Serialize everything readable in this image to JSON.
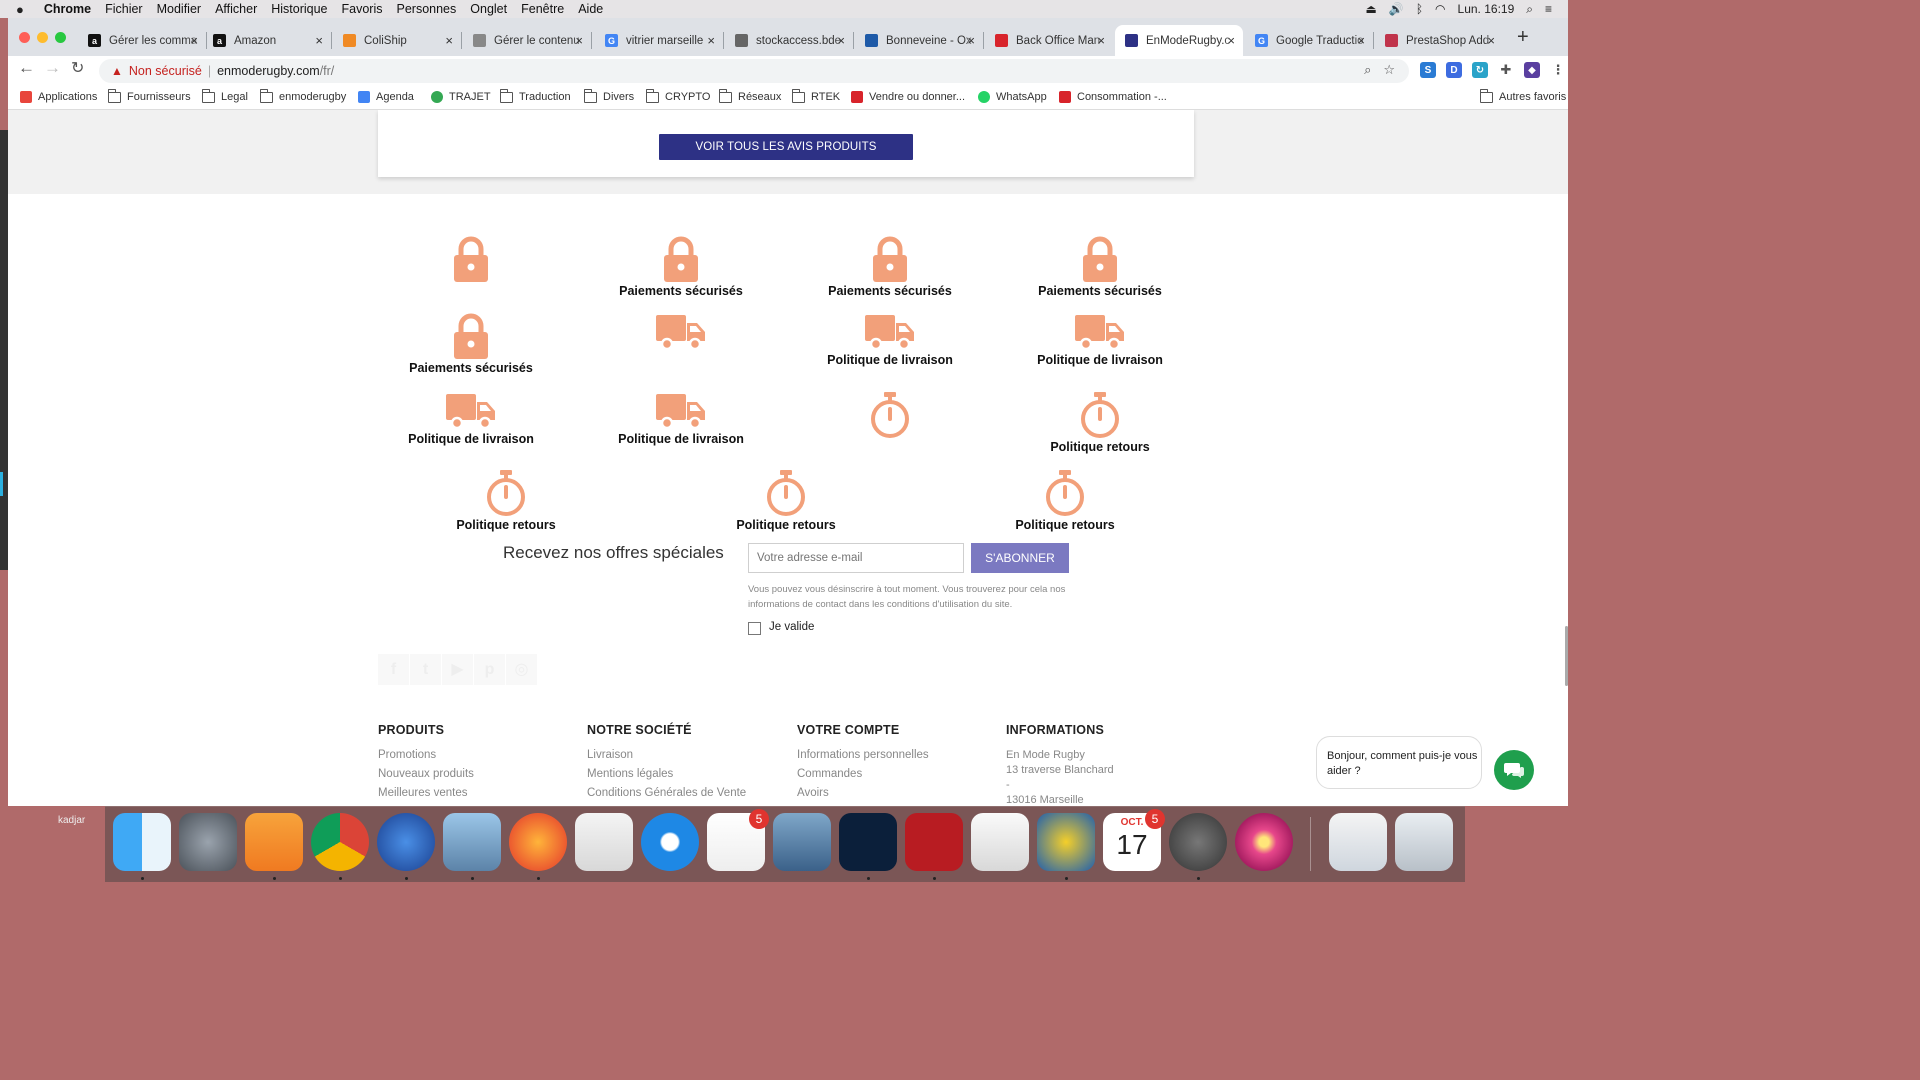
{
  "menubar": {
    "app": "Chrome",
    "items": [
      "Fichier",
      "Modifier",
      "Afficher",
      "Historique",
      "Favoris",
      "Personnes",
      "Onglet",
      "Fenêtre",
      "Aide"
    ],
    "clock": "Lun. 16:19"
  },
  "tabs": [
    {
      "title": "Gérer les comma",
      "fav": "a",
      "color": "#111"
    },
    {
      "title": "Amazon",
      "fav": "a",
      "color": "#111"
    },
    {
      "title": "ColiShip",
      "fav": "",
      "color": "#f08a24"
    },
    {
      "title": "Gérer le contenu",
      "fav": "",
      "color": "#888"
    },
    {
      "title": "vitrier marseille",
      "fav": "G",
      "color": "#4285f4"
    },
    {
      "title": "stockaccess.bde",
      "fav": "",
      "color": "#666"
    },
    {
      "title": "Bonneveine - Ox",
      "fav": "",
      "color": "#1e5aa8"
    },
    {
      "title": "Back Office Man",
      "fav": "",
      "color": "#d8242b"
    },
    {
      "title": "EnModeRugby.c",
      "fav": "",
      "color": "#2d3185"
    },
    {
      "title": "Google Traductio",
      "fav": "G",
      "color": "#4285f4"
    },
    {
      "title": "PrestaShop Add",
      "fav": "",
      "color": "#c0334b"
    }
  ],
  "omnibox": {
    "security": "Non sécurisé",
    "domain": "enmoderugby.com",
    "path": "/fr/"
  },
  "bookmarks": [
    {
      "label": "Applications",
      "type": "apps"
    },
    {
      "label": "Fournisseurs",
      "type": "folder"
    },
    {
      "label": "Legal",
      "type": "folder"
    },
    {
      "label": "enmoderugby",
      "type": "folder"
    },
    {
      "label": "Agenda",
      "type": "cal"
    },
    {
      "label": "TRAJET",
      "type": "map"
    },
    {
      "label": "Traduction",
      "type": "folder"
    },
    {
      "label": "Divers",
      "type": "folder"
    },
    {
      "label": "CRYPTO",
      "type": "folder"
    },
    {
      "label": "Réseaux",
      "type": "folder"
    },
    {
      "label": "RTEK",
      "type": "folder"
    },
    {
      "label": "Vendre ou donner...",
      "type": "fr"
    },
    {
      "label": "WhatsApp",
      "type": "wa"
    },
    {
      "label": "Consommation -...",
      "type": "fr"
    }
  ],
  "bookmarks_other": "Autres favoris",
  "reviews": {
    "button": "VOIR TOUS LES AVIS PRODUITS"
  },
  "features": {
    "accent": "#f2a07a",
    "labels": {
      "payment": "Paiements sécurisés",
      "delivery": "Politique de livraison",
      "returns": "Politique retours"
    },
    "items": [
      {
        "icon": "lock-icon",
        "label": ""
      },
      {
        "icon": "lock-icon",
        "label": "Paiements sécurisés"
      },
      {
        "icon": "lock-icon",
        "label": "Paiements sécurisés"
      },
      {
        "icon": "lock-icon",
        "label": "Paiements sécurisés"
      },
      {
        "icon": "lock-icon",
        "label": "Paiements sécurisés"
      },
      {
        "icon": "truck-icon",
        "label": ""
      },
      {
        "icon": "truck-icon",
        "label": "Politique de livraison"
      },
      {
        "icon": "truck-icon",
        "label": "Politique de livraison"
      },
      {
        "icon": "truck-icon",
        "label": "Politique de livraison"
      },
      {
        "icon": "truck-icon",
        "label": "Politique de livraison"
      },
      {
        "icon": "stopwatch-icon",
        "label": ""
      },
      {
        "icon": "stopwatch-icon",
        "label": "Politique retours"
      },
      {
        "icon": "stopwatch-icon",
        "label": "Politique retours"
      },
      {
        "icon": "stopwatch-icon",
        "label": "Politique retours"
      },
      {
        "icon": "stopwatch-icon",
        "label": "Politique retours"
      }
    ]
  },
  "newsletter": {
    "title": "Recevez nos offres spéciales",
    "placeholder": "Votre adresse e-mail",
    "button": "S'ABONNER",
    "note": "Vous pouvez vous désinscrire à tout moment. Vous trouverez pour cela nos informations de contact dans les conditions d'utilisation du site.",
    "checkbox_label": "Je valide"
  },
  "social": [
    "facebook-icon",
    "twitter-icon",
    "youtube-icon",
    "pinterest-icon",
    "instagram-icon"
  ],
  "footer": {
    "products": {
      "title": "PRODUITS",
      "items": [
        "Promotions",
        "Nouveaux produits",
        "Meilleures ventes"
      ]
    },
    "company": {
      "title": "NOTRE SOCIÉTÉ",
      "items": [
        "Livraison",
        "Mentions légales",
        "Conditions Générales de Vente"
      ]
    },
    "account": {
      "title": "VOTRE COMPTE",
      "items": [
        "Informations personnelles",
        "Commandes",
        "Avoirs"
      ]
    },
    "info": {
      "title": "INFORMATIONS",
      "lines": [
        "En Mode Rugby",
        "13 traverse Blanchard",
        "-",
        "13016 Marseille"
      ]
    }
  },
  "chat": {
    "message": "Bonjour, comment puis-je vous aider ?"
  },
  "dock": {
    "user": "kadjar",
    "badges": {
      "reminders": "5",
      "calendar": "5"
    },
    "calendar_month": "OCT.",
    "calendar_day": "17"
  }
}
